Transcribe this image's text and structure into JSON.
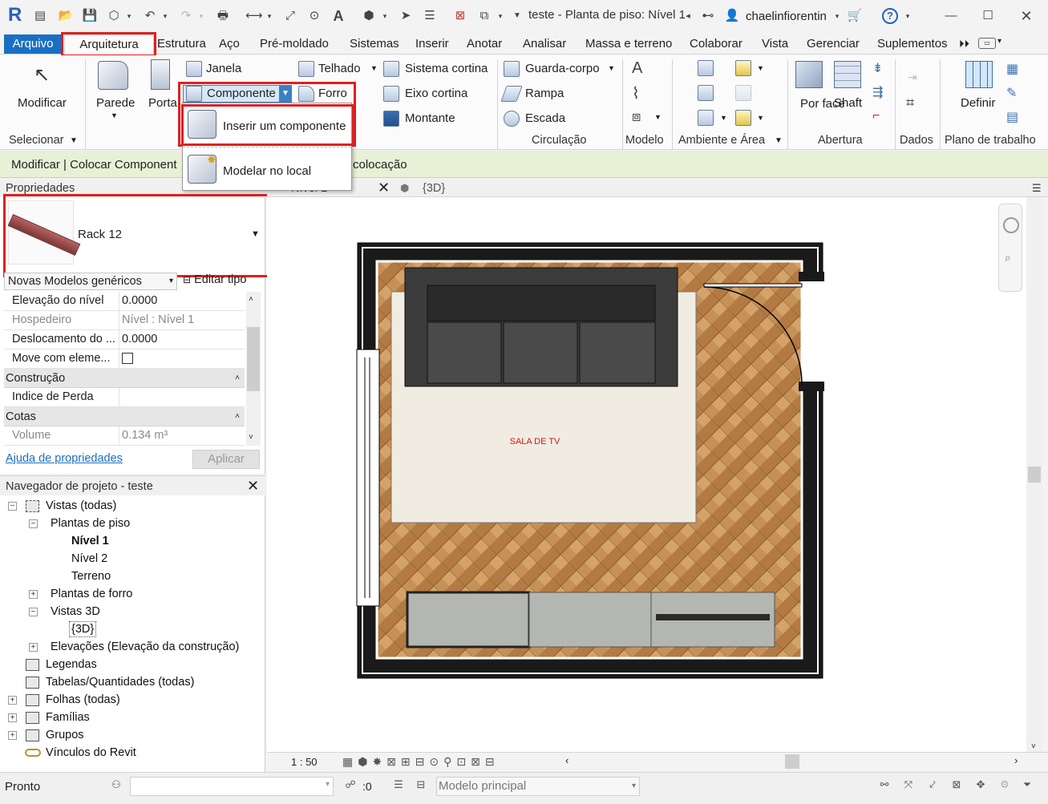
{
  "titlebar": {
    "logo": "R",
    "title": "teste - Planta de piso: Nível 1",
    "user": "chaelinfiorentin",
    "help": "?"
  },
  "ribbon_tabs": [
    "Arquivo",
    "Arquitetura",
    "Estrutura",
    "Aço",
    "Pré-moldado",
    "Sistemas",
    "Inserir",
    "Anotar",
    "Analisar",
    "Massa e terreno",
    "Colaborar",
    "Vista",
    "Gerenciar",
    "Suplementos"
  ],
  "ribbon": {
    "modify": "Modificar",
    "select_group": "Selecionar",
    "wall": "Parede",
    "door": "Porta",
    "window": "Janela",
    "component": "Componente",
    "ceiling": "Forro",
    "roof": "Telhado",
    "curtain_system": "Sistema  cortina",
    "curtain_grid": "Eixo  cortina",
    "mullion": "Montante",
    "railing": "Guarda-corpo",
    "ramp": "Rampa",
    "stair": "Escada",
    "circulation_group": "Circulação",
    "model_group": "Modelo",
    "room_area_group": "Ambiente e Área",
    "by_face": "Por face",
    "shaft": "Shaft",
    "opening_group": "Abertura",
    "datum_group": "Dados",
    "set": "Definir",
    "workplane_group": "Plano de trabalho"
  },
  "component_dropdown": {
    "items": [
      "Inserir um componente",
      "Modelar no local"
    ]
  },
  "options_bar": {
    "context": "Modificar | Colocar Component",
    "trailing": "colocação"
  },
  "properties": {
    "header": "Propriedades",
    "type_name": "Rack 12",
    "category": "Novas Modelos genéricos",
    "edit_type": "Editar tipo",
    "rows_constraints": [
      {
        "key": "Elevação do nível",
        "value": "0.0000"
      },
      {
        "key": "Hospedeiro",
        "value": "Nível : Nível 1"
      },
      {
        "key": "Deslocamento do ...",
        "value": "0.0000"
      },
      {
        "key": "Move com eleme...",
        "value": ""
      }
    ],
    "section_construction": "Construção",
    "row_construction": {
      "key": "Indice de Perda",
      "value": ""
    },
    "section_dimensions": "Cotas",
    "row_volume": {
      "key": "Volume",
      "value": "0.134 m³"
    },
    "help_link": "Ajuda de propriedades",
    "apply": "Aplicar"
  },
  "project_browser": {
    "header": "Navegador de projeto - teste",
    "views_all": "Vistas (todas)",
    "floor_plans": "Plantas de piso",
    "level1": "Nível 1",
    "level2": "Nível 2",
    "site": "Terreno",
    "ceiling_plans": "Plantas de forro",
    "views3d": "Vistas 3D",
    "view3d_item": "{3D}",
    "elevations": "Elevações (Elevação da construção)",
    "legends": "Legendas",
    "schedules": "Tabelas/Quantidades (todas)",
    "sheets": "Folhas (todas)",
    "families": "Famílias",
    "groups": "Grupos",
    "links": "Vínculos do Revit"
  },
  "view_tabs": {
    "level_tab": "Nível 1",
    "tab_3d": "{3D}"
  },
  "drawing": {
    "room_label": "SALA DE TV"
  },
  "view_bar": {
    "scale": "1 : 50"
  },
  "statusbar": {
    "status": "Pronto",
    "count": ":0",
    "model": "Modelo principal"
  },
  "colors": {
    "accent": "#1a6fc4",
    "highlight_red": "#e02020",
    "wood": "#c08a52",
    "options_bar": "#e8f0d6"
  }
}
